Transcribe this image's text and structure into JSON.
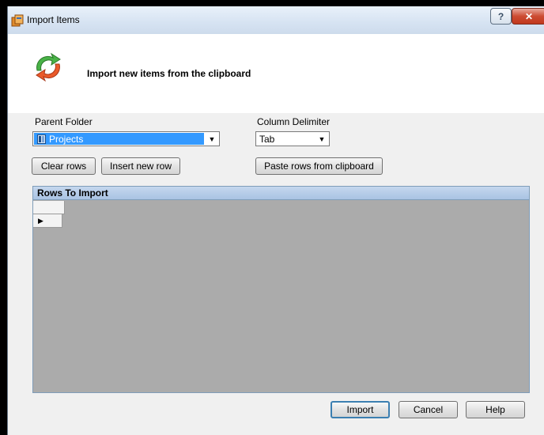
{
  "window": {
    "title": "Import Items"
  },
  "header": {
    "text": "Import new items from the clipboard"
  },
  "parent_folder": {
    "label": "Parent Folder",
    "value": "Projects"
  },
  "column_delimiter": {
    "label": "Column Delimiter",
    "value": "Tab"
  },
  "buttons": {
    "clear_rows": "Clear rows",
    "insert_row": "Insert new row",
    "paste_rows": "Paste rows from clipboard",
    "import": "Import",
    "cancel": "Cancel",
    "help": "Help"
  },
  "caption_buttons": {
    "help": "?",
    "close": "✕"
  },
  "grid": {
    "caption": "Rows To Import",
    "row_indicator": "▶"
  },
  "icons": {
    "dropdown_arrow": "▼"
  },
  "colors": {
    "selection": "#3399ff",
    "grid_background": "#ababab",
    "grid_caption": "#b6cbe8"
  }
}
